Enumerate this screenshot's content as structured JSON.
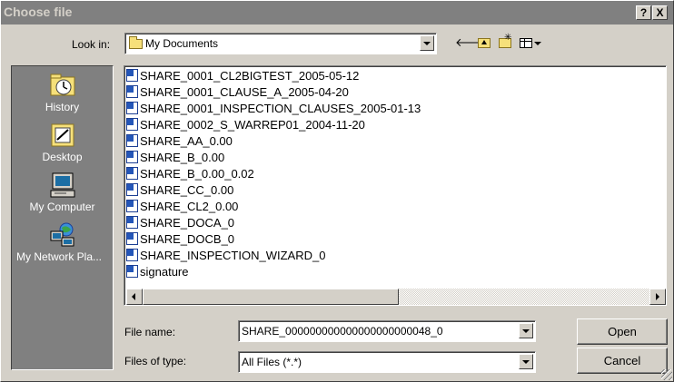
{
  "window": {
    "title": "Choose file",
    "help_label": "?",
    "close_label": "X"
  },
  "toolbar": {
    "look_in_label": "Look in:",
    "look_in_value": "My Documents",
    "back_icon": "back-arrow-icon",
    "up_icon": "up-one-level-icon",
    "new_folder_icon": "create-new-folder-icon",
    "view_menu_icon": "view-menu-icon"
  },
  "places": [
    {
      "label": "History",
      "icon": "history-icon"
    },
    {
      "label": "Desktop",
      "icon": "desktop-icon"
    },
    {
      "label": "My Computer",
      "icon": "my-computer-icon"
    },
    {
      "label": "My Network Pla...",
      "icon": "my-network-places-icon"
    }
  ],
  "files": [
    "SHARE_0001_CL2BIGTEST_2005-05-12",
    "SHARE_0001_CLAUSE_A_2005-04-20",
    "SHARE_0001_INSPECTION_CLAUSES_2005-01-13",
    "SHARE_0002_S_WARREP01_2004-11-20",
    "SHARE_AA_0.00",
    "SHARE_B_0.00",
    "SHARE_B_0.00_0.02",
    "SHARE_CC_0.00",
    "SHARE_CL2_0.00",
    "SHARE_DOCA_0",
    "SHARE_DOCB_0",
    "SHARE_INSPECTION_WIZARD_0",
    "signature"
  ],
  "form": {
    "file_name_label": "File name:",
    "file_name_value": "SHARE_000000000000000000000048_0",
    "files_of_type_label": "Files of type:",
    "files_of_type_value": "All Files (*.*)"
  },
  "buttons": {
    "open": "Open",
    "cancel": "Cancel"
  },
  "colors": {
    "dialog_bg": "#d4d0c8",
    "titlebar_bg": "#808080",
    "places_bg": "#808080",
    "list_bg": "#ffffff"
  }
}
